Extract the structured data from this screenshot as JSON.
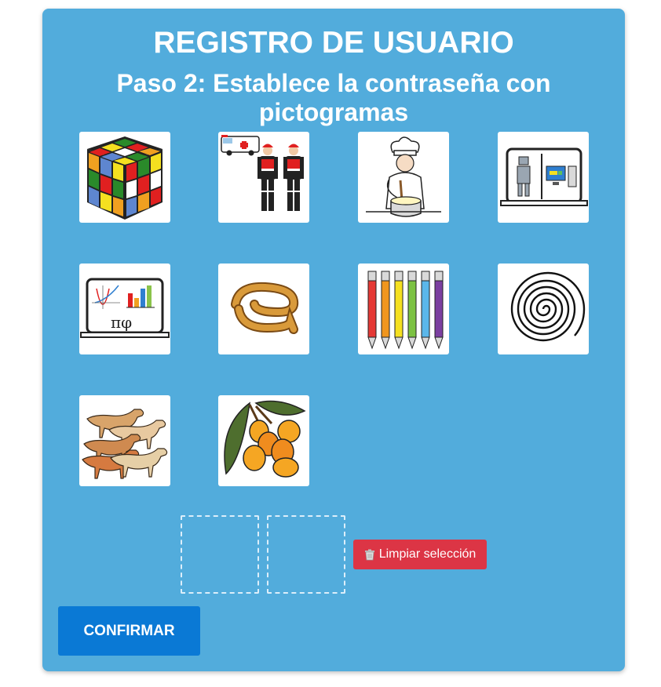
{
  "page": {
    "title": "REGISTRO DE USUARIO",
    "subtitle": "Paso 2: Establece la contraseña con pictogramas"
  },
  "pictograms": [
    {
      "icon": "rubiks-cube-icon"
    },
    {
      "icon": "paramedics-ambulance-icon"
    },
    {
      "icon": "chef-cooking-icon"
    },
    {
      "icon": "computer-robotics-icon"
    },
    {
      "icon": "laptop-math-icon"
    },
    {
      "icon": "churro-icon"
    },
    {
      "icon": "colored-markers-icon"
    },
    {
      "icon": "spiral-icon"
    },
    {
      "icon": "dogs-group-icon"
    },
    {
      "icon": "loquats-fruit-icon"
    }
  ],
  "selection": {
    "slots": 2,
    "clear_icon": "trash-icon",
    "clear_label": "Limpiar selección"
  },
  "actions": {
    "confirm_label": "CONFIRMAR"
  },
  "colors": {
    "card": "#52acdc",
    "clear_button": "#dc3545",
    "confirm_button": "#0a79d5"
  }
}
